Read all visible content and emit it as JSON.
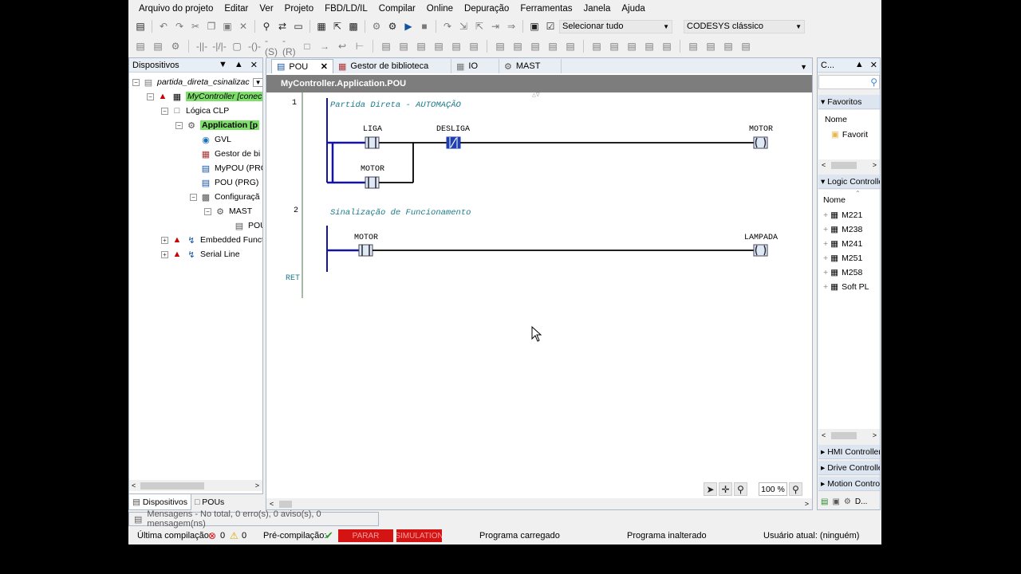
{
  "menu": [
    "Arquivo do projeto",
    "Editar",
    "Ver",
    "Projeto",
    "FBD/LD/IL",
    "Compilar",
    "Online",
    "Depuração",
    "Ferramentas",
    "Janela",
    "Ajuda"
  ],
  "toolbar": {
    "select_all": "Selecionar tudo",
    "style_combo": "CODESYS clássico"
  },
  "devices": {
    "title": "Dispositivos",
    "tree": [
      {
        "label": "partida_direta_csinalizac",
        "italic": true
      },
      {
        "label": "MyController [conect",
        "italic": true,
        "highlight": true
      },
      {
        "label": "Lógica CLP"
      },
      {
        "label": "Application [p",
        "bold": true,
        "highlight": true
      },
      {
        "label": "GVL"
      },
      {
        "label": "Gestor de bi"
      },
      {
        "label": "MyPOU (PRG"
      },
      {
        "label": "POU (PRG)"
      },
      {
        "label": "Configuraçã"
      },
      {
        "label": "MAST"
      },
      {
        "label": "POU"
      },
      {
        "label": "Embedded Funct"
      },
      {
        "label": "Serial Line"
      }
    ],
    "tabs": [
      "Dispositivos",
      "POUs"
    ]
  },
  "editor": {
    "tabs": [
      "POU",
      "Gestor de biblioteca",
      "IO",
      "MAST"
    ],
    "path": "MyController.Application.POU",
    "networks": [
      {
        "number": "1",
        "comment": "Partida Direta - AUTOMAÇÃO",
        "contacts": [
          "LIGA",
          "DESLIGA"
        ],
        "parallel": "MOTOR",
        "coil": "MOTOR"
      },
      {
        "number": "2",
        "comment": "Sinalização de Funcionamento",
        "contacts": [
          "MOTOR"
        ],
        "coil": "LAMPADA"
      }
    ],
    "ret": "RET",
    "zoom": "100 %"
  },
  "library": {
    "title": "C...",
    "favorites": {
      "header": "Favoritos",
      "col": "Nome",
      "items": [
        "Favorit"
      ]
    },
    "logic": {
      "header": "Logic Controlle",
      "col": "Nome",
      "items": [
        "M221",
        "M238",
        "M241",
        "M251",
        "M258",
        "Soft PL"
      ]
    },
    "sections": [
      "HMI Controller",
      "Drive Controlle",
      "Motion Contro"
    ],
    "bottom_label": "D..."
  },
  "messages": "Mensagens - No total, 0 erro(s), 0 aviso(s), 0 mensagem(ns)",
  "status": {
    "last_compile": "Última compilação:",
    "errors": "0",
    "warnings": "0",
    "precompile": "Pré-compilação:",
    "stop_badge": "PARAR",
    "sim_badge": "SIMULATION",
    "program_loaded": "Programa carregado",
    "program_unchanged": "Programa inalterado",
    "user": "Usuário atual: (ninguém)"
  }
}
